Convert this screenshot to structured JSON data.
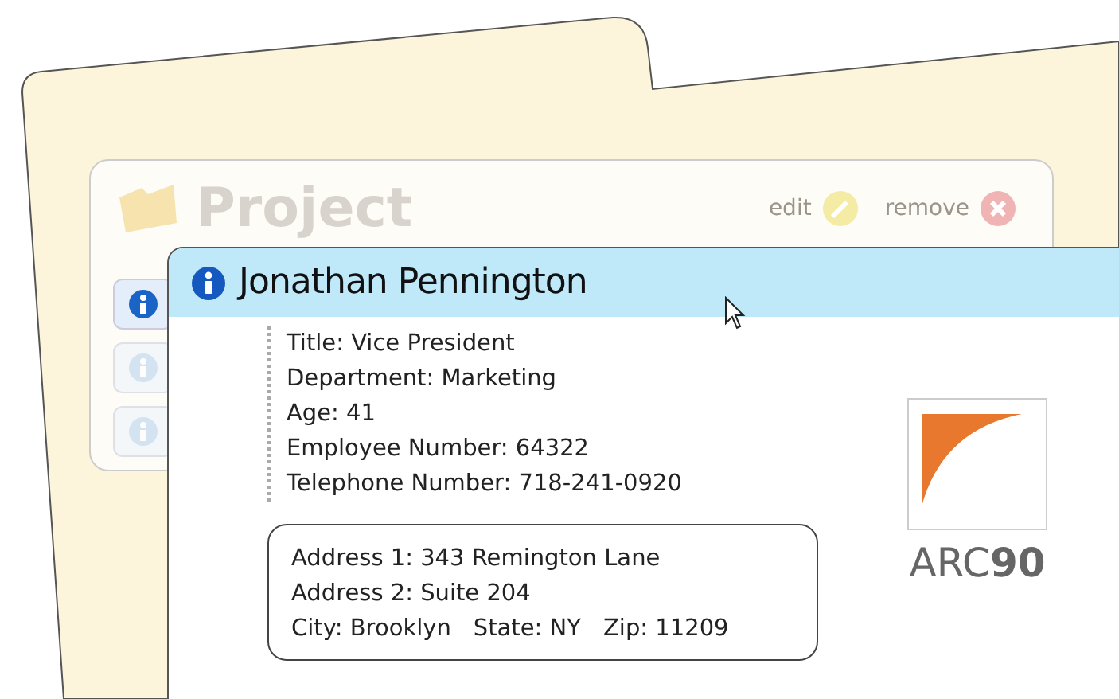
{
  "project": {
    "title": "Project",
    "actions": [
      {
        "kind": "edit",
        "label": "edit"
      },
      {
        "kind": "remove",
        "label": "remove"
      }
    ],
    "rows": [
      {
        "selected": true
      },
      {
        "selected": false
      },
      {
        "selected": false
      }
    ]
  },
  "card": {
    "name": "Jonathan Pennington",
    "fields": [
      "Title: Vice President",
      "Department: Marketing",
      "Age: 41",
      "Employee Number: 64322",
      "Telephone Number: 718-241-0920"
    ],
    "address": {
      "lines": [
        "Address 1: 343 Remington Lane",
        "Address 2: Suite 204"
      ],
      "city": "City: Brooklyn",
      "state": "State: NY",
      "zip": "Zip: 11209"
    },
    "logo": "ARC**90**"
  }
}
